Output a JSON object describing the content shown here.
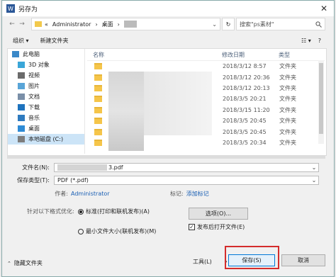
{
  "window": {
    "title": "另存为",
    "close_glyph": "✕"
  },
  "address": {
    "back": "←",
    "forward": "→",
    "crumbs": [
      "«",
      "Administrator",
      "›",
      "桌面",
      "›"
    ],
    "dropdown": "⌄",
    "refresh": "↻",
    "search_placeholder": "搜索\"ps素材\"",
    "search_icon": "search-icon"
  },
  "toolbar": {
    "organize": "组织 ▾",
    "new_folder": "新建文件夹",
    "view_icon": "☷ ▾",
    "help": "?"
  },
  "nav": {
    "items": [
      {
        "label": "此电脑",
        "icon": "computer-icon",
        "color": "#3a88c8"
      },
      {
        "label": "3D 对象",
        "icon": "cube-icon",
        "color": "#3aa6d8"
      },
      {
        "label": "视频",
        "icon": "video-icon",
        "color": "#6b6b6b"
      },
      {
        "label": "图片",
        "icon": "picture-icon",
        "color": "#59a5d8"
      },
      {
        "label": "文档",
        "icon": "document-icon",
        "color": "#7a8fa8"
      },
      {
        "label": "下载",
        "icon": "download-icon",
        "color": "#1e73be"
      },
      {
        "label": "音乐",
        "icon": "music-icon",
        "color": "#2f7bbf"
      },
      {
        "label": "桌面",
        "icon": "desktop-icon",
        "color": "#2e8bd6"
      },
      {
        "label": "本地磁盘 (C:)",
        "icon": "drive-icon",
        "color": "#7d7d7d"
      }
    ]
  },
  "list": {
    "headers": {
      "name": "名称",
      "date": "修改日期",
      "type": "类型"
    },
    "rows": [
      {
        "date": "2018/3/12 8:57",
        "type": "文件夹"
      },
      {
        "date": "2018/3/12 20:36",
        "type": "文件夹"
      },
      {
        "date": "2018/3/12 20:13",
        "type": "文件夹"
      },
      {
        "date": "2018/3/5 20:21",
        "type": "文件夹"
      },
      {
        "date": "2018/3/15 11:20",
        "type": "文件夹"
      },
      {
        "date": "2018/3/5 20:45",
        "type": "文件夹"
      },
      {
        "date": "2018/3/5 20:45",
        "type": "文件夹"
      },
      {
        "date": "2018/3/5 20:34",
        "type": "文件夹"
      }
    ]
  },
  "form": {
    "filename_label": "文件名(N):",
    "filename_value": "3.pdf",
    "filetype_label": "保存类型(T):",
    "filetype_value": "PDF (*.pdf)",
    "author_label": "作者:",
    "author_value": "Administrator",
    "tag_label": "标记:",
    "tag_value": "添加标记",
    "optimize_label": "针对以下格式优化:",
    "opt_standard": "标准(打印和联机发布)(A)",
    "opt_min": "最小文件大小(联机发布)(M)",
    "options_button": "选项(O)...",
    "open_after": "发布后打开文件(E)",
    "check_mark": "✓"
  },
  "footer": {
    "hide_folders": "隐藏文件夹",
    "tools": "工具(L)",
    "save": "保存(S)",
    "cancel": "取消"
  }
}
